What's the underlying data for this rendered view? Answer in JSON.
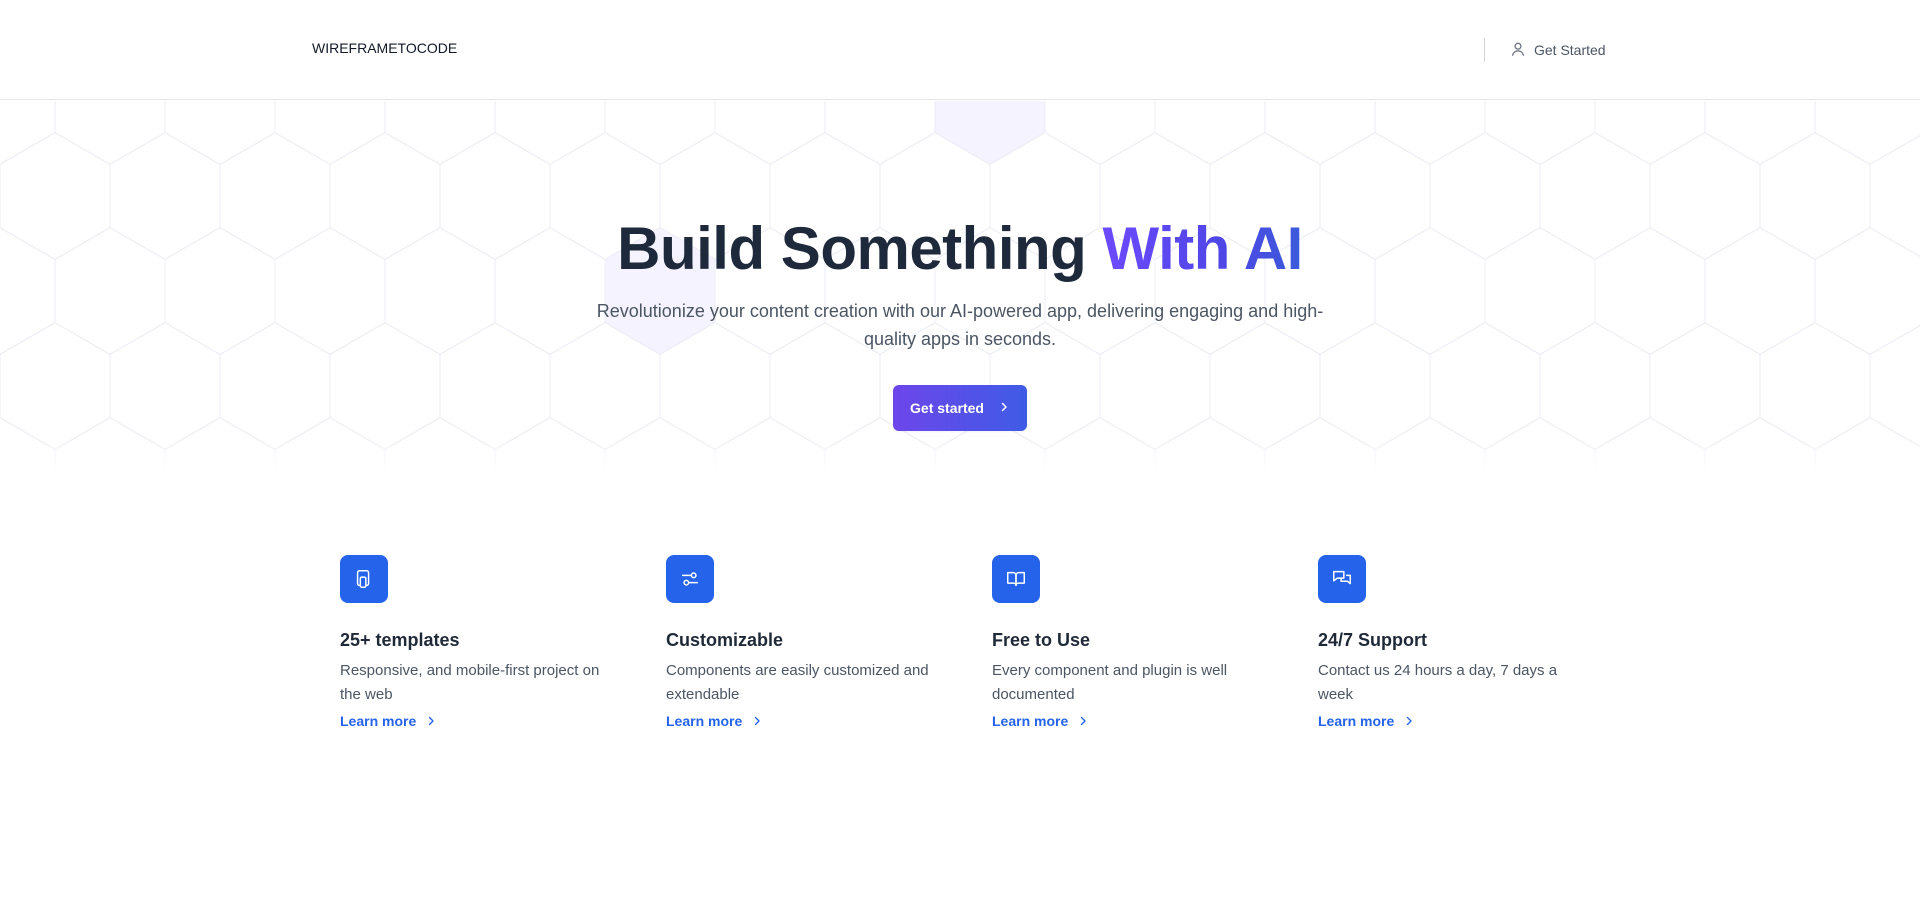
{
  "header": {
    "brand": "WIREFRAMETOCODE",
    "cta_label": "Get Started",
    "cta_icon": "user-icon"
  },
  "hero": {
    "title_main": "Build Something ",
    "title_accent": "With AI",
    "subtitle": "Revolutionize your content creation with our AI-powered app, delivering engaging and high-quality apps in seconds.",
    "button_label": "Get started",
    "button_icon": "chevron-right-icon"
  },
  "features": [
    {
      "icon": "tablet-icon",
      "title": "25+ templates",
      "description": "Responsive, and mobile-first project on the web",
      "link": "Learn more"
    },
    {
      "icon": "sliders-icon",
      "title": "Customizable",
      "description": "Components are easily customized and extendable",
      "link": "Learn more"
    },
    {
      "icon": "book-open-icon",
      "title": "Free to Use",
      "description": "Every component and plugin is well documented",
      "link": "Learn more"
    },
    {
      "icon": "chat-bubbles-icon",
      "title": "24/7 Support",
      "description": "Contact us 24 hours a day, 7 days a week",
      "link": "Learn more"
    }
  ],
  "colors": {
    "accent_blue": "#2563eb",
    "accent_purple": "#6d46ea",
    "heading": "#1e293b",
    "body_text": "#4b5563"
  }
}
